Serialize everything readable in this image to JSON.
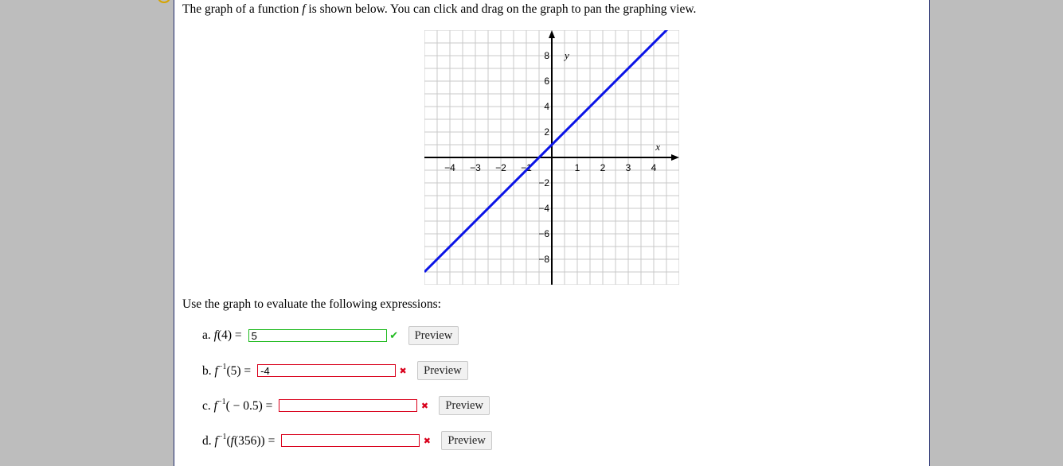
{
  "intro_text_before": "The graph of a function ",
  "intro_fn": "f",
  "intro_text_after": " is shown below. You can click and drag on the graph to pan the graphing view.",
  "use_graph_text": "Use the graph to evaluate the following expressions:",
  "preview_label": "Preview",
  "colors": {
    "line": "#0b14e6",
    "grid": "#c8c8c8",
    "correct": "#1fba1f",
    "incorrect": "#d9001b"
  },
  "graph": {
    "axis_label_x": "x",
    "axis_label_y": "y",
    "x_ticks": [
      "−4",
      "−3",
      "−2",
      "−1",
      "1",
      "2",
      "3",
      "4"
    ],
    "y_ticks": [
      "8",
      "6",
      "4",
      "2",
      "−2",
      "−4",
      "−6",
      "−8"
    ],
    "x_range": [
      -5,
      5
    ],
    "y_range": [
      -10,
      10
    ],
    "line": {
      "slope": 2,
      "intercept": 1
    }
  },
  "questions": [
    {
      "letter": "a.",
      "fn": "f",
      "inv": "",
      "arg": "(4)",
      "value": "5",
      "status": "correct",
      "mark": "✔"
    },
    {
      "letter": "b.",
      "fn": "f",
      "inv": "−1",
      "arg": "(5)",
      "value": "-4",
      "status": "incorrect",
      "mark": "✖"
    },
    {
      "letter": "c.",
      "fn": "f",
      "inv": "−1",
      "arg": "( − 0.5)",
      "value": "",
      "status": "incorrect",
      "mark": "✖"
    },
    {
      "letter": "d.",
      "fn": "f",
      "inv": "−1",
      "arg_open": "(",
      "inner_fn": "f",
      "arg_inner": "(356))",
      "value": "",
      "status": "incorrect",
      "mark": "✖"
    }
  ]
}
